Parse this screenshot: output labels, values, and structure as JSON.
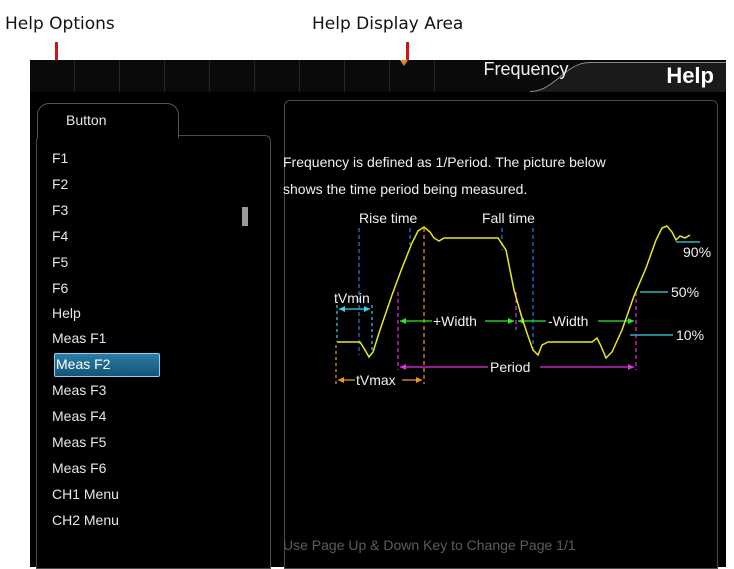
{
  "callouts": {
    "help_options": "Help Options",
    "help_display_area": "Help Display Area"
  },
  "header": {
    "title": "Help"
  },
  "left_panel": {
    "tab_label": "Button",
    "items": [
      "F1",
      "F2",
      "F3",
      "F4",
      "F5",
      "F6",
      "Help",
      "Meas F1",
      "Meas F2",
      "Meas F3",
      "Meas F4",
      "Meas F5",
      "Meas F6",
      "CH1 Menu",
      "CH2 Menu"
    ],
    "selected": "Meas F2"
  },
  "help": {
    "heading": "Frequency",
    "description_line1": "Frequency is defined as 1/Period. The picture below",
    "description_line2": "shows the time period being measured.",
    "footer": "Use Page Up & Down Key to Change Page  1/1"
  },
  "diagram": {
    "labels": {
      "rise_time": "Rise time",
      "fall_time": "Fall time",
      "tvmin": "tVmin",
      "tvmax": "tVmax",
      "plus_width": "+Width",
      "minus_width": "-Width",
      "period": "Period",
      "level_90": "90%",
      "level_50": "50%",
      "level_10": "10%"
    },
    "colors": {
      "waveform": "#e8e81c",
      "rise_fall_markers": "#1e7fe6",
      "level_lines": "#35d6e6",
      "width_markers": "#2ee82e",
      "period_markers": "#e630e6",
      "tvmax_markers": "#f09a1a",
      "tvmin_markers": "#35d6e6"
    }
  }
}
